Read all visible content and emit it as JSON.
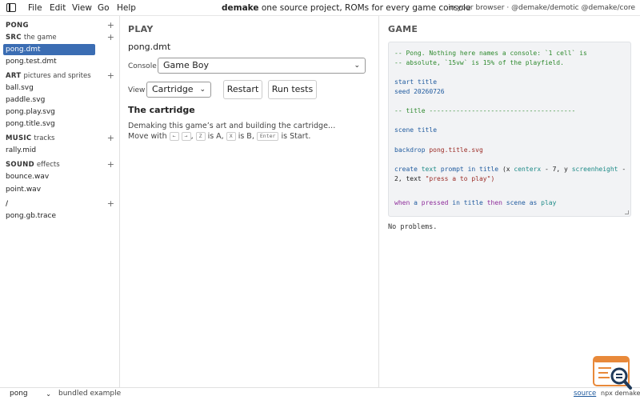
{
  "menubar": {
    "items": [
      "File",
      "Edit",
      "View",
      "Go",
      "Help"
    ],
    "app_name": "demake",
    "tagline": "one source project, ROMs for every game console",
    "mode": "in your browser",
    "separator": "·",
    "links": [
      "@demake/demotic",
      "@demake/core"
    ]
  },
  "sidebar": {
    "project": {
      "name": "PONG",
      "add": "+"
    },
    "sections": [
      {
        "name": "SRC",
        "desc": "the game",
        "add": "+",
        "files": [
          "pong.dmt",
          "pong.test.dmt"
        ]
      },
      {
        "name": "ART",
        "desc": "pictures and sprites",
        "add": "+",
        "files": [
          "ball.svg",
          "paddle.svg",
          "pong.play.svg",
          "pong.title.svg"
        ]
      },
      {
        "name": "MUSIC",
        "desc": "tracks",
        "add": "+",
        "files": [
          "rally.mid"
        ]
      },
      {
        "name": "SOUND",
        "desc": "effects",
        "add": "+",
        "files": [
          "bounce.wav",
          "point.wav"
        ]
      },
      {
        "name": "/",
        "desc": "",
        "add": "+",
        "files": [
          "pong.gb.trace"
        ]
      }
    ],
    "active_file": "pong.dmt"
  },
  "play": {
    "title": "PLAY",
    "filename": "pong.dmt",
    "console_label": "Console",
    "console_value": "Game Boy",
    "view_label": "View",
    "view_value": "Cartridge",
    "restart_label": "Restart",
    "run_tests_label": "Run tests",
    "cartridge_heading": "The cartridge",
    "status_text": "Demaking this game’s art and building the cartridge…",
    "help": {
      "prefix": "Move with",
      "key_left": "←",
      "key_right": "→",
      "sep1": ",",
      "key_a": "Z",
      "a_text": "is A,",
      "key_b": "X",
      "b_text": "is B,",
      "key_start": "Enter",
      "start_text": "is Start."
    }
  },
  "game": {
    "title": "GAME",
    "code": {
      "l1": "-- Pong. Nothing here names a console: `1 cell` is",
      "l2": "-- absolute, `15vw` is 15% of the playfield.",
      "l4_kw": "start",
      "l4_val": "title",
      "l5_kw": "seed",
      "l5_val": "20260726",
      "l7": "-- title --------------------------------------",
      "l9_kw": "scene",
      "l9_val": "title",
      "l11_kw": "backdrop",
      "l11_val": "pong.title.svg",
      "l13_create": "create",
      "l13_text": "text",
      "l13_prompt": "prompt",
      "l13_in": "in",
      "l13_title": "title",
      "l13_paren": "(x",
      "l13_centerx": "centerx",
      "l13_minus7": "- 7, y",
      "l13_sh": "screenheight",
      "l13_minus": "-",
      "l14_num": "2,",
      "l14_text": "text",
      "l14_str": "\"press a to play\")",
      "l16_when": "when",
      "l16_a": "a",
      "l16_pressed": "pressed",
      "l16_in": "in",
      "l16_title": "title",
      "l16_then": "then",
      "l16_scene": "scene",
      "l16_as": "as",
      "l16_play": "play"
    },
    "problems": "No problems."
  },
  "statusbar": {
    "example": "pong",
    "note": "bundled example",
    "source": "source",
    "cmd": "npx  demake"
  },
  "colors": {
    "accent": "#3b6db3",
    "comment": "#2f8a2f",
    "keyword": "#1f5a9e",
    "string": "#9b2b25",
    "logo_orange": "#e8893a",
    "logo_navy": "#1f3a5a"
  }
}
